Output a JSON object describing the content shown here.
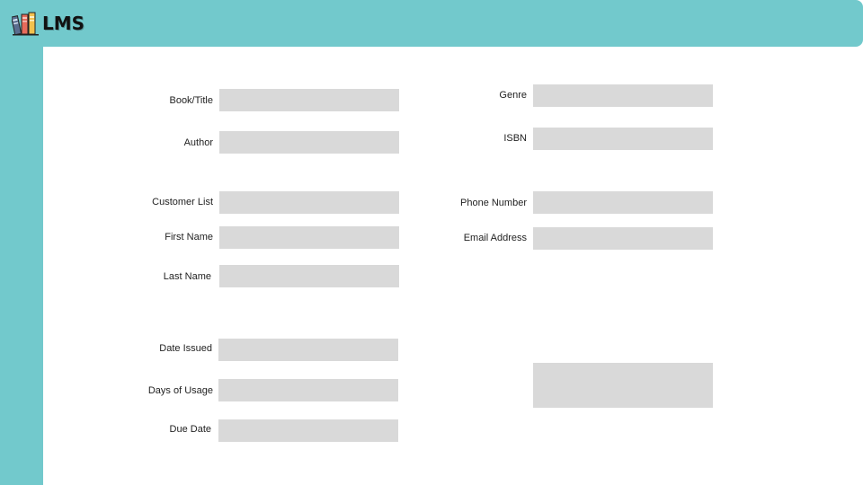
{
  "app": {
    "logo_text": "LMS",
    "colors": {
      "accent": "#72c9cc",
      "field_bg": "#d9d9d9",
      "text": "#222222"
    },
    "logo_icon": "books-icon"
  },
  "form": {
    "book_title": {
      "label": "Book/Title",
      "value": ""
    },
    "author": {
      "label": "Author",
      "value": ""
    },
    "genre": {
      "label": "Genre",
      "value": ""
    },
    "isbn": {
      "label": "ISBN",
      "value": ""
    },
    "customer_list": {
      "label": "Customer List",
      "value": ""
    },
    "first_name": {
      "label": "First Name",
      "value": ""
    },
    "last_name": {
      "label": "Last Name",
      "value": ""
    },
    "phone_number": {
      "label": "Phone Number",
      "value": ""
    },
    "email_address": {
      "label": "Email Address",
      "value": ""
    },
    "date_issued": {
      "label": "Date Issued",
      "value": ""
    },
    "days_of_usage": {
      "label": "Days of Usage",
      "value": ""
    },
    "due_date": {
      "label": "Due Date",
      "value": ""
    },
    "notes": {
      "value": ""
    }
  }
}
